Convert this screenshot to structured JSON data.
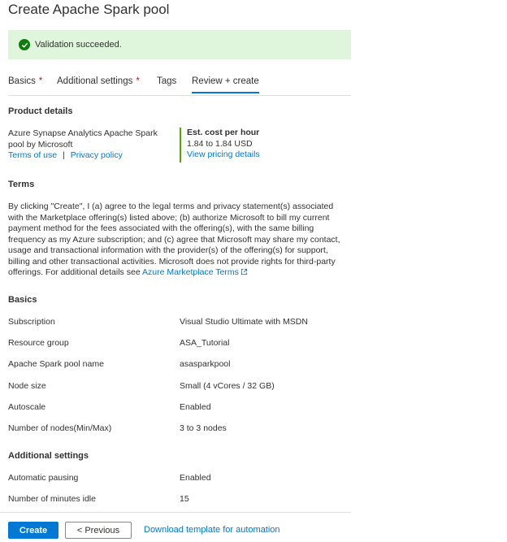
{
  "page": {
    "title": "Create Apache Spark pool"
  },
  "banner": {
    "text": "Validation succeeded.",
    "icon": "check-circle-icon",
    "color": "#107c10"
  },
  "tabs": [
    {
      "label": "Basics",
      "required": "*"
    },
    {
      "label": "Additional settings",
      "required": "*"
    },
    {
      "label": "Tags"
    },
    {
      "label": "Review + create",
      "active": true
    }
  ],
  "product": {
    "heading": "Product details",
    "name_line1": "Azure Synapse Analytics Apache Spark",
    "name_line2": "pool by Microsoft",
    "terms_link": "Terms of use",
    "separator": "|",
    "privacy_link": "Privacy policy",
    "cost_title": "Est. cost per hour",
    "cost_value": "1.84 to 1.84 USD",
    "pricing_link": "View pricing details"
  },
  "terms": {
    "heading": "Terms",
    "lines": [
      "By clicking \"Create\", I (a) agree to the legal terms and privacy statement(s) associated",
      "with the Marketplace offering(s) listed above; (b) authorize Microsoft to bill my current",
      "payment method for the fees associated with the offering(s), with the same billing",
      "frequency as my Azure subscription; and (c) agree that Microsoft may share my contact,",
      "usage and transactional information with the provider(s) of the offering(s) for support,",
      "billing and other transactional activities. Microsoft does not provide rights for third-party"
    ],
    "last_line": "offerings. For additional details see ",
    "marketplace_link": "Azure Marketplace Terms"
  },
  "basics": {
    "heading": "Basics",
    "rows": [
      {
        "label": "Subscription",
        "value": "Visual Studio Ultimate with MSDN"
      },
      {
        "label": "Resource group",
        "value": "ASA_Tutorial"
      },
      {
        "label": "Apache Spark pool name",
        "value": "asasparkpool"
      },
      {
        "label": "Node size",
        "value": "Small (4 vCores / 32 GB)"
      },
      {
        "label": "Autoscale",
        "value": "Enabled"
      },
      {
        "label": "Number of nodes(Min/Max)",
        "value": "3 to 3 nodes"
      }
    ]
  },
  "additional": {
    "heading": "Additional settings",
    "rows": [
      {
        "label": "Automatic pausing",
        "value": "Enabled"
      },
      {
        "label": "Number of minutes idle",
        "value": "15"
      }
    ]
  },
  "footer": {
    "create": "Create",
    "previous": "< Previous",
    "download": "Download template for automation"
  }
}
